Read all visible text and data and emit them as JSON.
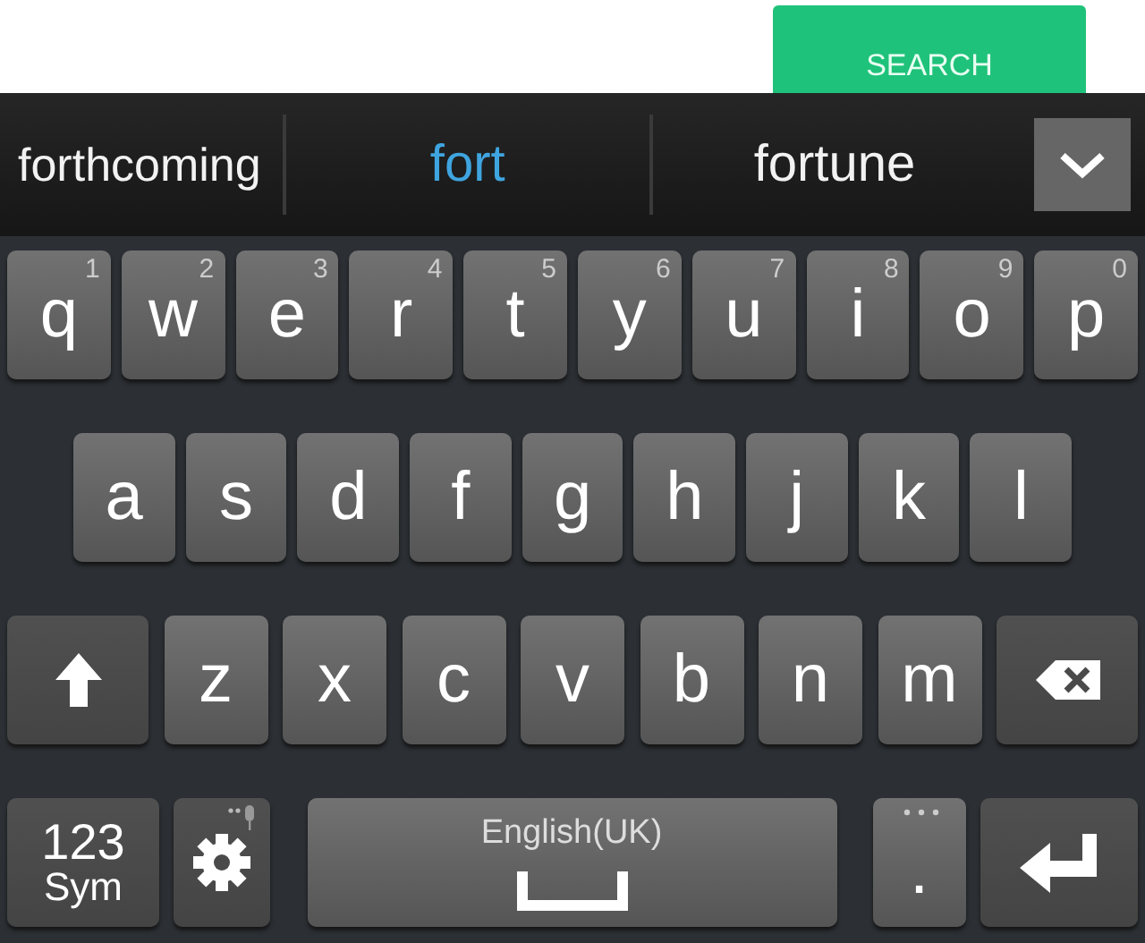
{
  "search_button": {
    "label": "SEARCH"
  },
  "suggestions": [
    {
      "text": "forthcoming",
      "selected": false
    },
    {
      "text": "fort",
      "selected": true
    },
    {
      "text": "fortune",
      "selected": false
    }
  ],
  "rows": [
    [
      {
        "kind": "letter",
        "label": "q",
        "hint": "1"
      },
      {
        "kind": "letter",
        "label": "w",
        "hint": "2"
      },
      {
        "kind": "letter",
        "label": "e",
        "hint": "3"
      },
      {
        "kind": "letter",
        "label": "r",
        "hint": "4"
      },
      {
        "kind": "letter",
        "label": "t",
        "hint": "5"
      },
      {
        "kind": "letter",
        "label": "y",
        "hint": "6"
      },
      {
        "kind": "letter",
        "label": "u",
        "hint": "7"
      },
      {
        "kind": "letter",
        "label": "i",
        "hint": "8"
      },
      {
        "kind": "letter",
        "label": "o",
        "hint": "9"
      },
      {
        "kind": "letter",
        "label": "p",
        "hint": "0"
      }
    ],
    [
      {
        "kind": "letter",
        "label": "a"
      },
      {
        "kind": "letter",
        "label": "s"
      },
      {
        "kind": "letter",
        "label": "d"
      },
      {
        "kind": "letter",
        "label": "f"
      },
      {
        "kind": "letter",
        "label": "g"
      },
      {
        "kind": "letter",
        "label": "h"
      },
      {
        "kind": "letter",
        "label": "j"
      },
      {
        "kind": "letter",
        "label": "k"
      },
      {
        "kind": "letter",
        "label": "l"
      }
    ],
    [
      {
        "kind": "shift"
      },
      {
        "kind": "letter",
        "label": "z"
      },
      {
        "kind": "letter",
        "label": "x"
      },
      {
        "kind": "letter",
        "label": "c"
      },
      {
        "kind": "letter",
        "label": "v"
      },
      {
        "kind": "letter",
        "label": "b"
      },
      {
        "kind": "letter",
        "label": "n"
      },
      {
        "kind": "letter",
        "label": "m"
      },
      {
        "kind": "backspace"
      }
    ],
    [
      {
        "kind": "sym",
        "label": "123",
        "sublabel": "Sym"
      },
      {
        "kind": "settings"
      },
      {
        "kind": "space",
        "label": "English(UK)"
      },
      {
        "kind": "period",
        "label": "."
      },
      {
        "kind": "enter"
      }
    ]
  ]
}
